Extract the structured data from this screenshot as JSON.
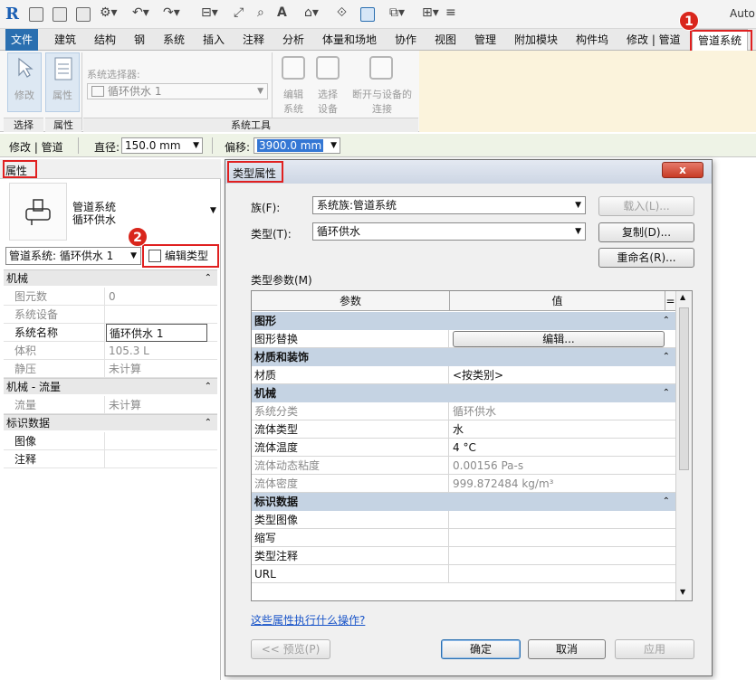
{
  "app": {
    "title_fragment": "Auto"
  },
  "ribbon": {
    "tabs": [
      "文件",
      "建筑",
      "结构",
      "钢",
      "系统",
      "插入",
      "注释",
      "分析",
      "体量和场地",
      "协作",
      "视图",
      "管理",
      "附加模块",
      "构件坞",
      "修改 | 管道",
      "管道系统"
    ],
    "buttons": {
      "modify": "修改",
      "properties": "属性",
      "selector_label": "系统选择器:",
      "selector_value": "循环供水 1",
      "edit_system": [
        "编辑",
        "系统"
      ],
      "select_equipment": [
        "选择",
        "设备"
      ],
      "disconnect": [
        "断开与设备的",
        "连接"
      ]
    },
    "panels": {
      "select": "选择",
      "props": "属性",
      "system_tools": "系统工具"
    }
  },
  "options_bar": {
    "context": "修改 | 管道",
    "diameter_label": "直径:",
    "diameter_value": "150.0 mm",
    "offset_label": "偏移:",
    "offset_value": "3900.0 mm"
  },
  "properties": {
    "header": "属性",
    "type_name": "管道系统",
    "type_sub": "循环供水",
    "instance_selector": "管道系统: 循环供水 1",
    "edit_type": "编辑类型",
    "groups": [
      {
        "name": "机械",
        "rows": [
          {
            "k": "图元数",
            "v": "0",
            "dim": true
          },
          {
            "k": "系统设备",
            "v": "",
            "dim": true
          },
          {
            "k": "系统名称",
            "v": "循环供水 1",
            "dim": false
          },
          {
            "k": "体积",
            "v": "105.3 L",
            "dim": true
          },
          {
            "k": "静压",
            "v": "未计算",
            "dim": true
          }
        ]
      },
      {
        "name": "机械 - 流量",
        "rows": [
          {
            "k": "流量",
            "v": "未计算",
            "dim": true
          }
        ]
      },
      {
        "name": "标识数据",
        "rows": [
          {
            "k": "图像",
            "v": "",
            "dim": false
          },
          {
            "k": "注释",
            "v": "",
            "dim": false
          }
        ]
      }
    ]
  },
  "dialog": {
    "title": "类型属性",
    "close": "x",
    "family_label": "族(F):",
    "family_value": "系统族:管道系统",
    "type_label": "类型(T):",
    "type_value": "循环供水",
    "load_btn": "载入(L)...",
    "duplicate_btn": "复制(D)...",
    "rename_btn": "重命名(R)...",
    "params_label": "类型参数(M)",
    "col_param": "参数",
    "col_value": "值",
    "col_eq": "=",
    "groups": [
      {
        "name": "图形",
        "rows": [
          {
            "k": "图形替换",
            "v": "编辑...",
            "button": true
          }
        ]
      },
      {
        "name": "材质和装饰",
        "rows": [
          {
            "k": "材质",
            "v": "<按类别>"
          }
        ]
      },
      {
        "name": "机械",
        "rows": [
          {
            "k": "系统分类",
            "v": "循环供水",
            "dim": true
          },
          {
            "k": "流体类型",
            "v": "水"
          },
          {
            "k": "流体温度",
            "v": "4 °C"
          },
          {
            "k": "流体动态粘度",
            "v": "0.00156 Pa-s",
            "dim": true
          },
          {
            "k": "流体密度",
            "v": "999.872484 kg/m³",
            "dim": true
          }
        ]
      },
      {
        "name": "标识数据",
        "rows": [
          {
            "k": "类型图像",
            "v": ""
          },
          {
            "k": "缩写",
            "v": ""
          },
          {
            "k": "类型注释",
            "v": ""
          },
          {
            "k": "URL",
            "v": ""
          }
        ]
      }
    ],
    "help_link": "这些属性执行什么操作?",
    "preview_btn": "<< 预览(P)",
    "ok_btn": "确定",
    "cancel_btn": "取消",
    "apply_btn": "应用"
  },
  "annotations": {
    "badge1": "1",
    "badge2": "2"
  },
  "colors": {
    "file_tab": "#2a6fb0",
    "highlight": "#e02020",
    "group_bg": "#c5d3e3",
    "context_tab_bg": "#fbf3dc"
  }
}
